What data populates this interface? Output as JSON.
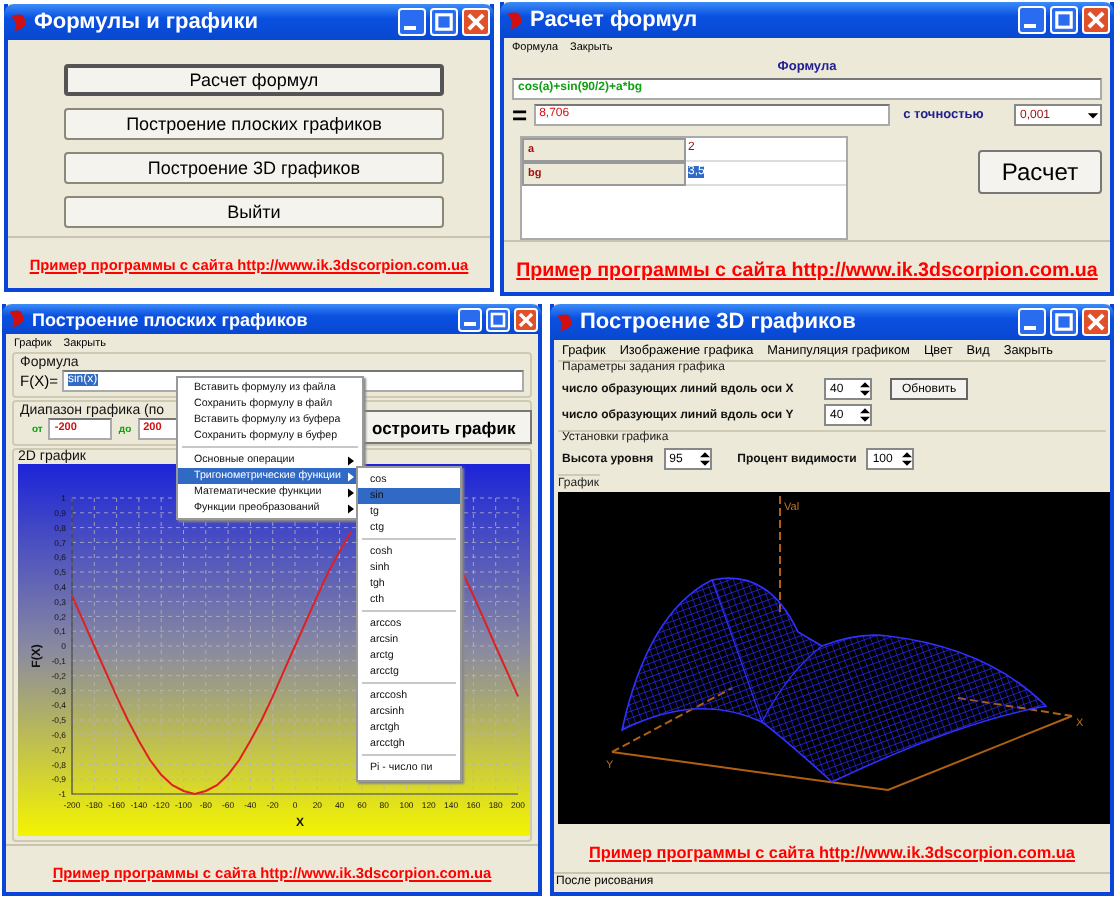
{
  "main_window": {
    "title": "Формулы и графики",
    "buttons": [
      {
        "label": "Расчет формул",
        "focused": true
      },
      {
        "label": "Построение плоских графиков",
        "focused": false
      },
      {
        "label": "Построение 3D графиков",
        "focused": false
      },
      {
        "label": "Выйти",
        "focused": false
      }
    ],
    "footer_link": "Пример программы с сайта http://www.ik.3dscorpion.com.ua"
  },
  "formula_window": {
    "title": "Расчет формул",
    "menu": [
      "Формула",
      "Закрыть"
    ],
    "heading": "Формула",
    "formula": "cos(a)+sin(90/2)+a*bg",
    "equals": "=",
    "result": "8,706",
    "precision_label": "с точностью",
    "precision": "0,001",
    "variables": [
      {
        "name": "a",
        "value": "2",
        "selected": false
      },
      {
        "name": "bg",
        "value": "3,5",
        "selected": true
      }
    ],
    "button": "Расчет",
    "footer_link": "Пример программы с сайта http://www.ik.3dscorpion.com.ua"
  },
  "plot2d_window": {
    "title": "Построение плоских графиков",
    "menu": [
      "График",
      "Закрыть"
    ],
    "formula_group": "Формула",
    "fx_label": "F(X)=",
    "formula": {
      "value": "sin(x)",
      "highlighted": true
    },
    "range_group": "Диапазон графика (по",
    "from_label": "от",
    "from": "-200",
    "to_label": "до",
    "to": "200",
    "build_button": "остроить график",
    "chart_group": "2D график",
    "chart_data": {
      "type": "line",
      "xlabel": "X",
      "ylabel": "F(X)",
      "x": [
        -200,
        -190,
        -180,
        -170,
        -160,
        -150,
        -140,
        -130,
        -120,
        -110,
        -100,
        -90,
        -80,
        -70,
        -60,
        -50,
        -40,
        -30,
        -20,
        -10,
        0,
        10,
        20,
        30,
        40,
        50,
        150,
        160,
        170,
        180,
        190,
        200
      ],
      "series": [
        {
          "color": "#e02020",
          "values": [
            0.34,
            0.17,
            0,
            -0.17,
            -0.34,
            -0.5,
            -0.64,
            -0.77,
            -0.87,
            -0.94,
            -0.98,
            -1,
            -0.98,
            -0.94,
            -0.87,
            -0.77,
            -0.64,
            -0.5,
            -0.34,
            -0.17,
            0,
            0.17,
            0.34,
            0.5,
            0.64,
            0.77,
            0.5,
            0.34,
            0.17,
            0,
            -0.17,
            -0.34
          ]
        }
      ],
      "grid": true,
      "xlim": [
        -200,
        200
      ],
      "ylim": [
        -1,
        1
      ],
      "xticks": [
        -200,
        -180,
        -160,
        -140,
        -120,
        -100,
        -80,
        -60,
        -40,
        -20,
        0,
        20,
        40,
        60,
        80,
        100,
        120,
        140,
        160,
        180,
        200
      ],
      "yticks": [
        {
          "value": 1,
          "label": "1"
        },
        {
          "value": 0.9,
          "label": "0,9"
        },
        {
          "value": 0.8,
          "label": "0,8"
        },
        {
          "value": 0.7,
          "label": "0,7"
        },
        {
          "value": 0.6,
          "label": "0,6"
        },
        {
          "value": 0.5,
          "label": "0,5"
        },
        {
          "value": 0.4,
          "label": "0,4"
        },
        {
          "value": 0.3,
          "label": "0,3"
        },
        {
          "value": 0.2,
          "label": "0,2"
        },
        {
          "value": 0.1,
          "label": "0,1"
        },
        {
          "value": 0,
          "label": "0"
        },
        {
          "value": -0.1,
          "label": "-0,1"
        },
        {
          "value": -0.2,
          "label": "-0,2"
        },
        {
          "value": -0.3,
          "label": "-0,3"
        },
        {
          "value": -0.4,
          "label": "-0,4"
        },
        {
          "value": -0.5,
          "label": "-0,5"
        },
        {
          "value": -0.6,
          "label": "-0,6"
        },
        {
          "value": -0.7,
          "label": "-0,7"
        },
        {
          "value": -0.8,
          "label": "-0,8"
        },
        {
          "value": -0.9,
          "label": "-0,9"
        },
        {
          "value": -1,
          "label": "-1"
        }
      ]
    },
    "context_menu": {
      "groups": [
        {
          "items": [
            {
              "label": "Вставить формулу из файла",
              "submenu": false,
              "selected": false
            },
            {
              "label": "Сохранить формулу в файл",
              "submenu": false,
              "selected": false
            },
            {
              "label": "Вставить формулу из буфера",
              "submenu": false,
              "selected": false
            },
            {
              "label": "Сохранить формулу в буфер",
              "submenu": false,
              "selected": false
            }
          ]
        },
        {
          "items": [
            {
              "label": "Основные операции",
              "submenu": true,
              "selected": false
            },
            {
              "label": "Тригонометрические функции",
              "submenu": true,
              "selected": true
            },
            {
              "label": "Математические функции",
              "submenu": true,
              "selected": false
            },
            {
              "label": "Функции преобразований",
              "submenu": true,
              "selected": false
            }
          ]
        }
      ]
    },
    "submenu": {
      "groups": [
        {
          "items": [
            {
              "label": "cos",
              "selected": false
            },
            {
              "label": "sin",
              "selected": true
            },
            {
              "label": "tg",
              "selected": false
            },
            {
              "label": "ctg",
              "selected": false
            }
          ]
        },
        {
          "items": [
            {
              "label": "cosh",
              "selected": false
            },
            {
              "label": "sinh",
              "selected": false
            },
            {
              "label": "tgh",
              "selected": false
            },
            {
              "label": "cth",
              "selected": false
            }
          ]
        },
        {
          "items": [
            {
              "label": "arccos",
              "selected": false
            },
            {
              "label": "arcsin",
              "selected": false
            },
            {
              "label": "arctg",
              "selected": false
            },
            {
              "label": "arcctg",
              "selected": false
            }
          ]
        },
        {
          "items": [
            {
              "label": "arccosh",
              "selected": false
            },
            {
              "label": "arcsinh",
              "selected": false
            },
            {
              "label": "arctgh",
              "selected": false
            },
            {
              "label": "arcctgh",
              "selected": false
            }
          ]
        },
        {
          "items": [
            {
              "label": "Pi - число пи",
              "selected": false
            }
          ]
        }
      ]
    },
    "footer_link": "Пример программы с сайта http://www.ik.3dscorpion.com.ua"
  },
  "plot3d_window": {
    "title": "Построение 3D графиков",
    "menu": [
      "График",
      "Изображение графика",
      "Манипуляция графиком",
      "Цвет",
      "Вид",
      "Закрыть"
    ],
    "params_group": "Параметры задания графика",
    "params": [
      {
        "label": "число образующих линий вдоль оси X",
        "value": "40"
      },
      {
        "label": "число образующих линий вдоль оси Y",
        "value": "40"
      }
    ],
    "refresh_button": "Обновить",
    "settings_group": "Установки графика",
    "settings": [
      {
        "label": "Высота уровня",
        "value": "95"
      },
      {
        "label": "Процент видимости",
        "value": "100"
      }
    ],
    "graph_group": "График",
    "axis_labels": {
      "vertical": "Val",
      "x": "X",
      "y": "Y"
    },
    "footer_link": "Пример программы с сайта http://www.ik.3dscorpion.com.ua",
    "status": "После рисования"
  }
}
